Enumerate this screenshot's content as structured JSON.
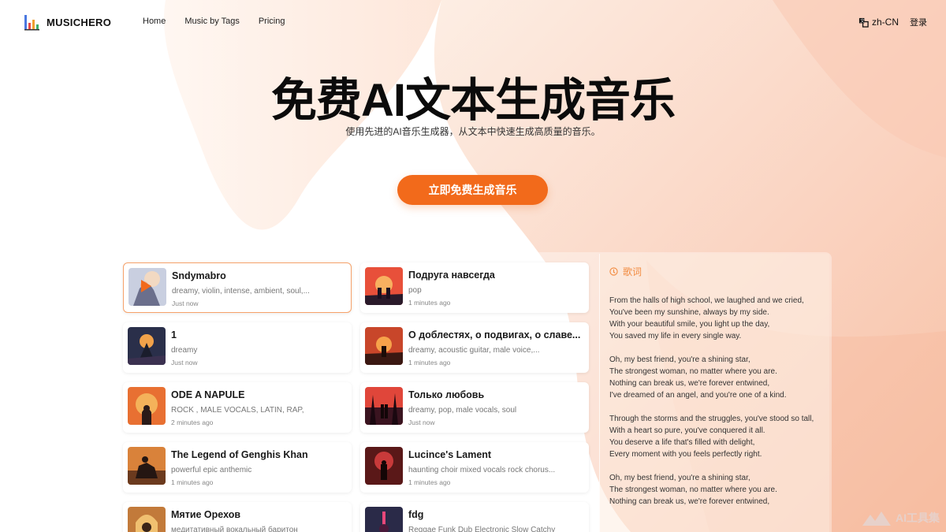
{
  "brand": {
    "name": "MUSICHERO"
  },
  "nav": {
    "items": [
      "Home",
      "Music by Tags",
      "Pricing"
    ]
  },
  "header": {
    "language": "zh-CN",
    "login_label": "登录"
  },
  "hero": {
    "title": "免费AI文本生成音乐",
    "subtitle": "使用先进的AI音乐生成器，从文本中快速生成高质量的音乐。",
    "cta_label": "立即免费生成音乐"
  },
  "songs_left": [
    {
      "title": "Sndymabro",
      "tags": "dreamy, violin, intense, ambient, soul,...",
      "time": "Just now"
    },
    {
      "title": "1",
      "tags": "dreamy",
      "time": "Just now"
    },
    {
      "title": "ODE A NAPULE",
      "tags": "ROCK , MALE VOCALS, LATIN, RAP,",
      "time": "2 minutes ago"
    },
    {
      "title": "The Legend of Genghis Khan",
      "tags": "powerful epic anthemic",
      "time": "1 minutes ago"
    },
    {
      "title": "Мятие Орехов",
      "tags": "медитативный вокальный баритон",
      "time": ""
    }
  ],
  "songs_right": [
    {
      "title": "Подруга навсегда",
      "tags": "pop",
      "time": "1 minutes ago"
    },
    {
      "title": "О доблестях, о подвигах, о славе...",
      "tags": "dreamy, acoustic guitar, male voice,...",
      "time": "1 minutes ago"
    },
    {
      "title": "Только любовь",
      "tags": "dreamy, pop, male vocals, soul",
      "time": "Just now"
    },
    {
      "title": "Lucince's Lament",
      "tags": "haunting choir mixed vocals rock chorus...",
      "time": "1 minutes ago"
    },
    {
      "title": "fdg",
      "tags": "Reggae Funk Dub Electronic Slow Catchy",
      "time": ""
    }
  ],
  "lyrics": {
    "label": "歌词",
    "text": "From the halls of high school, we laughed and we cried,\nYou've been my sunshine, always by my side.\nWith your beautiful smile, you light up the day,\nYou saved my life in every single way.\n\nOh, my best friend, you're a shining star,\nThe strongest woman, no matter where you are.\nNothing can break us, we're forever entwined,\nI've dreamed of an angel, and you're one of a kind.\n\nThrough the storms and the struggles, you've stood so tall,\nWith a heart so pure, you've conquered it all.\nYou deserve a life that's filled with delight,\nEvery moment with you feels perfectly right.\n\nOh, my best friend, you're a shining star,\nThe strongest woman, no matter where you are.\nNothing can break us, we're forever entwined,"
  },
  "watermark": {
    "text": "AI工具集"
  },
  "colors": {
    "accent": "#f26a1b",
    "selected_border": "#f6a26a",
    "lyrics_label": "#f28a3e"
  }
}
